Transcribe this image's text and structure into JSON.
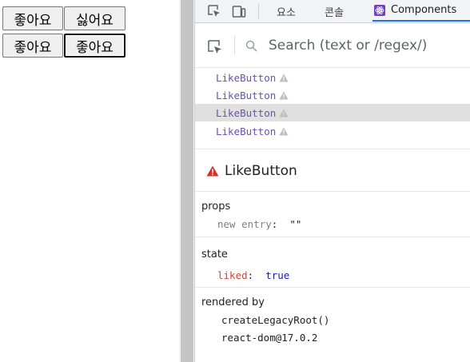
{
  "page": {
    "buttons": [
      {
        "label": "좋아요"
      },
      {
        "label": "싫어요"
      },
      {
        "label": "좋아요"
      },
      {
        "label": "좋아요"
      }
    ]
  },
  "devtools": {
    "tabs": [
      {
        "label": "요소"
      },
      {
        "label": "콘솔"
      },
      {
        "label": "Components",
        "active": true
      }
    ],
    "search": {
      "placeholder": "Search (text or /regex/)"
    },
    "tree": [
      {
        "label": "LikeButton",
        "warning": true
      },
      {
        "label": "LikeButton",
        "warning": true
      },
      {
        "label": "LikeButton",
        "warning": true,
        "selected": true
      },
      {
        "label": "LikeButton",
        "warning": true
      }
    ],
    "selected_component": {
      "name": "LikeButton"
    },
    "props": {
      "title": "props",
      "entry_key": "new entry",
      "entry_sep": ":",
      "entry_value": "\"\""
    },
    "state": {
      "title": "state",
      "key": "liked",
      "sep": ":",
      "value": "true"
    },
    "rendered_by": {
      "title": "rendered by",
      "items": [
        "createLegacyRoot()",
        "react-dom@17.0.2"
      ]
    }
  },
  "colors": {
    "tab_active_underline": "#1a73e8",
    "component_name": "#6a51b2",
    "warning": "#d93025",
    "state_key": "#d04437",
    "bool_value": "#1a1aa6",
    "selected_row": "#e0e0e0"
  },
  "icons": [
    "inspect-element-icon",
    "device-toolbar-icon",
    "react-logo-icon",
    "select-element-icon",
    "search-icon",
    "warning-icon"
  ]
}
